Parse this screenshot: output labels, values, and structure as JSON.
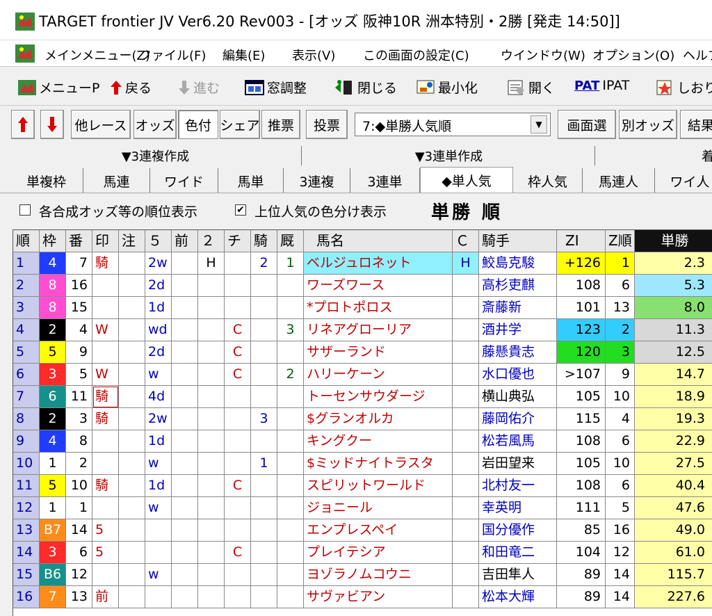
{
  "window": {
    "title": "TARGET frontier JV  Ver6.20  Rev003 - [オッズ 阪神10R 洲本特別・2勝  [発走 14:50]]"
  },
  "menu": [
    "メインメニュー(Z)",
    "ファイル(F)",
    "編集(E)",
    "表示(V)",
    "この画面の設定(C)",
    "ウインドウ(W)",
    "オプション(O)",
    "ヘルプ"
  ],
  "toolbar": {
    "menu_p": "メニューP",
    "back": "戻る",
    "forward": "進む",
    "window_adjust": "窓調整",
    "close": "閉じる",
    "minimize": "最小化",
    "open": "開く",
    "pat": "PAT",
    "ipat": "IPAT",
    "bookmark": "しおり"
  },
  "buttons": [
    "他レース",
    "オッズ",
    "色付",
    "シェア",
    "推票",
    "投票"
  ],
  "select_value": "7:◆単勝人気順",
  "right_buttons": [
    "画面選",
    "別オッズ",
    "結果"
  ],
  "create_bars": [
    "▼3連複作成",
    "▼3連単作成",
    "着"
  ],
  "tabs": [
    "単複枠",
    "馬連",
    "ワイド",
    "馬単",
    "3連複",
    "3連単",
    "◆単人気",
    "枠人気",
    "馬連人",
    "ワイ人"
  ],
  "options": {
    "opt1": "各合成オッズ等の順位表示",
    "opt2": "上位人気の色分け表示",
    "opt2_checked": "✔",
    "big_title": "単勝 順"
  },
  "headers": [
    "順",
    "枠",
    "番",
    "印",
    "注",
    "５",
    "前",
    "２",
    "チ",
    "騎",
    "厩",
    "馬名",
    "Ｃ",
    "騎手",
    "ZI",
    "Z順",
    "単勝"
  ],
  "colors": {
    "waku": {
      "1": "#ffffff",
      "2": "#000000",
      "3": "#ff2a2a",
      "4": "#1f3cff",
      "5": "#ffff00",
      "6": "#16908a",
      "7": "#ff8c1a",
      "8": "#ff4fd0"
    }
  },
  "rows": [
    {
      "rank": "1",
      "waku": "4",
      "ban": "7",
      "mark": "騎",
      "ch": "",
      "m5": "2w",
      "mae": "",
      "n2": "H",
      "chi": "",
      "ki": "2",
      "kyu": "1",
      "name": "ベルジュロネット",
      "c": "H",
      "jockey": "鮫島克駿",
      "zi": "+126",
      "zj": "1",
      "odds": "2.3"
    },
    {
      "rank": "2",
      "waku": "8",
      "ban": "16",
      "mark": "",
      "ch": "",
      "m5": "2d",
      "mae": "",
      "n2": "",
      "chi": "",
      "ki": "",
      "kyu": "",
      "name": "ワーズワース",
      "c": "",
      "jockey": "高杉吏麒",
      "zi": "108",
      "zj": "6",
      "odds": "5.3"
    },
    {
      "rank": "3",
      "waku": "8",
      "ban": "15",
      "mark": "",
      "ch": "",
      "m5": "1d",
      "mae": "",
      "n2": "",
      "chi": "",
      "ki": "",
      "kyu": "",
      "name": "*プロトポロス",
      "c": "",
      "jockey": "斎藤新",
      "zi": "101",
      "zj": "13",
      "odds": "8.0"
    },
    {
      "rank": "4",
      "waku": "2",
      "ban": "4",
      "mark": "W",
      "ch": "",
      "m5": "wd",
      "mae": "",
      "n2": "",
      "chi": "C",
      "ki": "",
      "kyu": "3",
      "name": "リネアグローリア",
      "c": "",
      "jockey": "酒井学",
      "zi": "123",
      "zj": "2",
      "odds": "11.3"
    },
    {
      "rank": "5",
      "waku": "5",
      "ban": "9",
      "mark": "",
      "ch": "",
      "m5": "2d",
      "mae": "",
      "n2": "",
      "chi": "C",
      "ki": "",
      "kyu": "",
      "name": "サザーランド",
      "c": "",
      "jockey": "藤懸貴志",
      "zi": "120",
      "zj": "3",
      "odds": "12.5"
    },
    {
      "rank": "6",
      "waku": "3",
      "ban": "5",
      "mark": "W",
      "ch": "",
      "m5": "w",
      "mae": "",
      "n2": "",
      "chi": "C",
      "ki": "",
      "kyu": "2",
      "name": "ハリーケーン",
      "c": "",
      "jockey": "水口優也",
      "zi": ">107",
      "zj": "9",
      "odds": "14.7"
    },
    {
      "rank": "7",
      "waku": "6",
      "ban": "11",
      "mark": "騎",
      "ch": "",
      "m5": "4d",
      "mae": "",
      "n2": "",
      "chi": "",
      "ki": "",
      "kyu": "",
      "name": "トーセンサウダージ",
      "c": "",
      "jockey": "横山典弘",
      "zi": "105",
      "zj": "10",
      "odds": "18.9"
    },
    {
      "rank": "8",
      "waku": "2",
      "ban": "3",
      "mark": "騎",
      "ch": "",
      "m5": "2w",
      "mae": "",
      "n2": "",
      "chi": "",
      "ki": "3",
      "kyu": "",
      "name": "$グランオルカ",
      "c": "",
      "jockey": "藤岡佑介",
      "zi": "115",
      "zj": "4",
      "odds": "19.3"
    },
    {
      "rank": "9",
      "waku": "4",
      "ban": "8",
      "mark": "",
      "ch": "",
      "m5": "1d",
      "mae": "",
      "n2": "",
      "chi": "",
      "ki": "",
      "kyu": "",
      "name": "キングクー",
      "c": "",
      "jockey": "松若風馬",
      "zi": "108",
      "zj": "6",
      "odds": "22.9"
    },
    {
      "rank": "10",
      "waku": "1",
      "ban": "2",
      "mark": "",
      "ch": "",
      "m5": "w",
      "mae": "",
      "n2": "",
      "chi": "",
      "ki": "1",
      "kyu": "",
      "name": "$ミッドナイトラスタ",
      "c": "",
      "jockey": "岩田望来",
      "zi": "105",
      "zj": "10",
      "odds": "27.5"
    },
    {
      "rank": "11",
      "waku": "5",
      "ban": "10",
      "mark": "騎",
      "ch": "",
      "m5": "1d",
      "mae": "",
      "n2": "",
      "chi": "C",
      "ki": "",
      "kyu": "",
      "name": "スピリットワールド",
      "c": "",
      "jockey": "北村友一",
      "zi": "108",
      "zj": "6",
      "odds": "40.4"
    },
    {
      "rank": "12",
      "waku": "1",
      "ban": "1",
      "mark": "",
      "ch": "",
      "m5": "w",
      "mae": "",
      "n2": "",
      "chi": "",
      "ki": "",
      "kyu": "",
      "name": "ジョニール",
      "c": "",
      "jockey": "幸英明",
      "zi": "111",
      "zj": "5",
      "odds": "47.6"
    },
    {
      "rank": "13",
      "waku": "B7",
      "ban": "14",
      "mark": "5",
      "ch": "",
      "m5": "",
      "mae": "",
      "n2": "",
      "chi": "",
      "ki": "",
      "kyu": "",
      "name": "エンプレスペイ",
      "c": "",
      "jockey": "国分優作",
      "zi": "85",
      "zj": "16",
      "odds": "49.0"
    },
    {
      "rank": "14",
      "waku": "3",
      "ban": "6",
      "mark": "5",
      "ch": "",
      "m5": "",
      "mae": "",
      "n2": "",
      "chi": "C",
      "ki": "",
      "kyu": "",
      "name": "プレイテシア",
      "c": "",
      "jockey": "和田竜二",
      "zi": "104",
      "zj": "12",
      "odds": "61.0"
    },
    {
      "rank": "15",
      "waku": "B6",
      "ban": "12",
      "mark": "",
      "ch": "",
      "m5": "w",
      "mae": "",
      "n2": "",
      "chi": "",
      "ki": "",
      "kyu": "",
      "name": "ヨゾラノムコウニ",
      "c": "",
      "jockey": "吉田隼人",
      "zi": "89",
      "zj": "14",
      "odds": "115.7"
    },
    {
      "rank": "16",
      "waku": "7",
      "ban": "13",
      "mark": "前",
      "ch": "",
      "m5": "",
      "mae": "",
      "n2": "",
      "chi": "",
      "ki": "",
      "kyu": "",
      "name": "サヴァビアン",
      "c": "",
      "jockey": "松本大輝",
      "zi": "89",
      "zj": "14",
      "odds": "227.6"
    }
  ]
}
